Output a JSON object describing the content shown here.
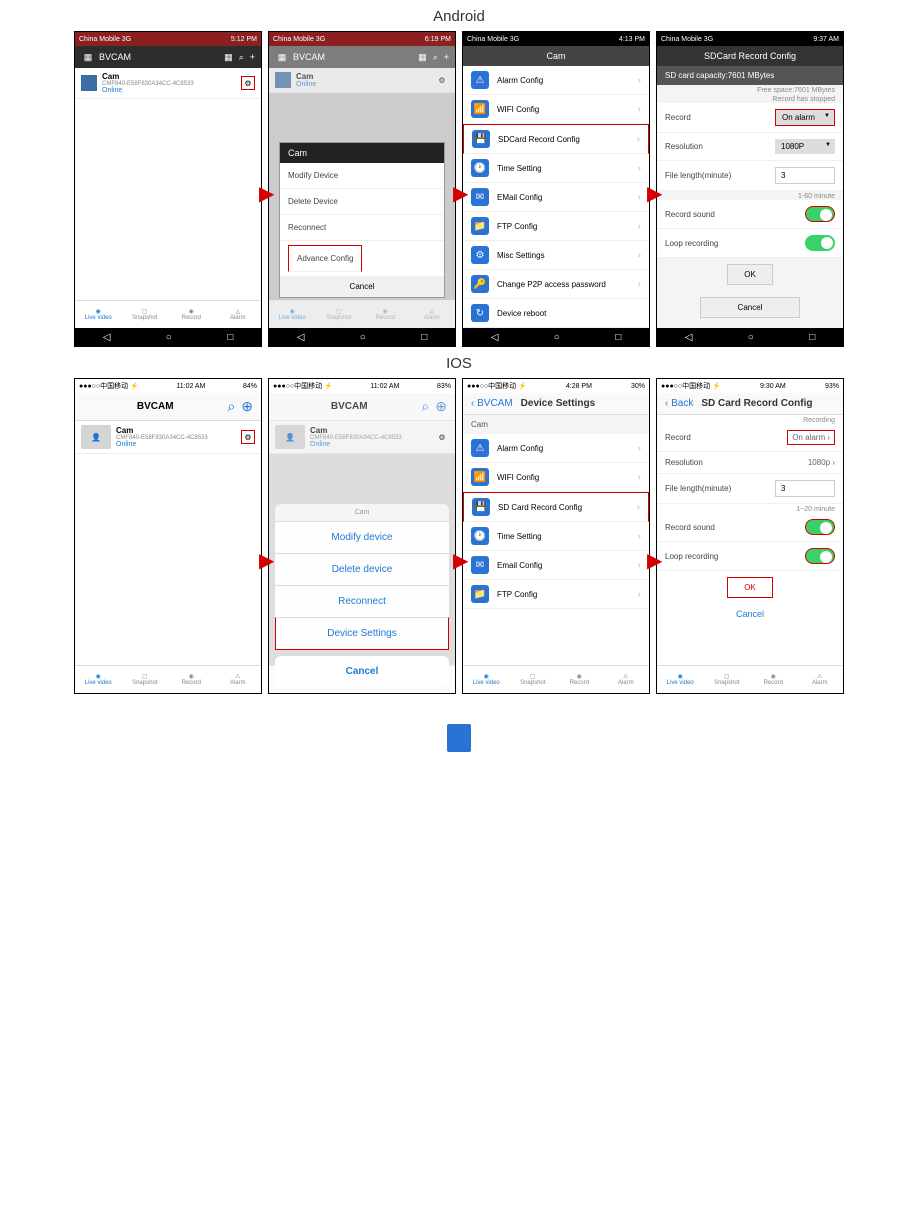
{
  "titles": {
    "android": "Android",
    "ios": "IOS"
  },
  "android": {
    "statusbar": {
      "carrier": "China Mobile 3G",
      "time1": "5:12 PM",
      "time2": "6:19 PM",
      "time3": "4:13 PM",
      "time4": "9:37 AM"
    },
    "appbar": {
      "title": "BVCAM"
    },
    "cam": {
      "name": "Cam",
      "id": "CMF840-E58F830A34CC-4C8533",
      "status": "Online"
    },
    "dialog": {
      "title": "Cam",
      "modify": "Modify Device",
      "delete": "Delete Device",
      "reconnect": "Reconnect",
      "advance": "Advance Config",
      "cancel": "Cancel"
    },
    "settings_hdr": "Cam",
    "settings": {
      "alarm": "Alarm Config",
      "wifi": "WIFI Config",
      "sdcard": "SDCard Record Config",
      "time": "Time Setting",
      "email": "EMail Config",
      "ftp": "FTP Config",
      "misc": "Misc Settings",
      "p2p": "Change P2P access password",
      "reboot": "Device reboot"
    },
    "sd": {
      "title": "SDCard Record Config",
      "capacity": "SD card capacity:7601 MBytes",
      "free": "Free space:7601 MBytes",
      "stopped": "Record has stopped",
      "record": "Record",
      "record_val": "On alarm",
      "resolution": "Resolution",
      "resolution_val": "1080P",
      "file_length": "File length(minute)",
      "file_length_val": "3",
      "range": "1-60 minute",
      "sound": "Record sound",
      "loop": "Loop recording",
      "ok": "OK",
      "cancel": "Cancel"
    },
    "tabs": {
      "live": "Live video",
      "snapshot": "Snapshot",
      "record": "Record",
      "alarm": "Alarm"
    }
  },
  "ios": {
    "statusbar": {
      "carrier": "●●●○○中国移动 ⚡",
      "time1": "11:02 AM",
      "time2": "11:02 AM",
      "time3": "4:28 PM",
      "time4": "9:30 AM",
      "bat1": "84%",
      "bat2": "83%",
      "bat3": "30%",
      "bat4": "93%"
    },
    "app": "BVCAM",
    "cam": {
      "name": "Cam",
      "id": "CMF840-E58F830A34CC-4C8533",
      "status": "Online"
    },
    "sheet": {
      "title": "Cam",
      "modify": "Modify device",
      "delete": "Delete device",
      "reconnect": "Reconnect",
      "device_settings": "Device Settings",
      "cancel": "Cancel"
    },
    "devset": {
      "back": "BVCAM",
      "title": "Device Settings",
      "section": "Cam",
      "alarm": "Alarm Config",
      "wifi": "WIFI Config",
      "sdcard": "SD Card Record Config",
      "time": "Time Setting",
      "email": "Email Config",
      "ftp": "FTP Config"
    },
    "sd": {
      "back": "Back",
      "title": "SD Card Record Config",
      "recording": "Recording",
      "record": "Record",
      "record_val": "On alarm",
      "resolution": "Resolution",
      "resolution_val": "1080p",
      "file_length": "File length(minute)",
      "file_length_val": "3",
      "range": "1~20 minute",
      "sound": "Record sound",
      "loop": "Loop recording",
      "ok": "OK",
      "cancel": "Cancel"
    },
    "tabs": {
      "live": "Live video",
      "snapshot": "Snapshot",
      "record": "Record",
      "alarm": "Alarm"
    }
  }
}
